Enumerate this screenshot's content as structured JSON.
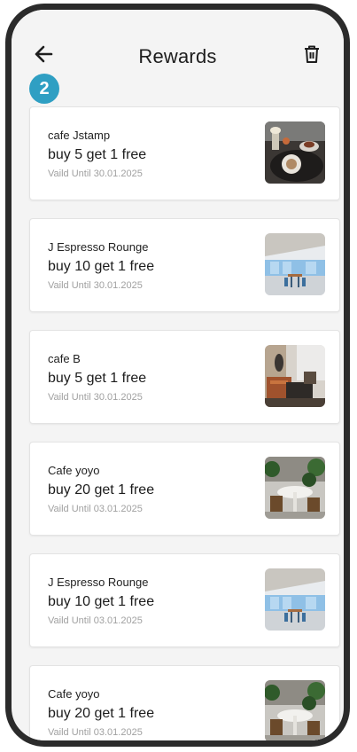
{
  "header": {
    "title": "Rewards",
    "back_icon": "arrow-left-icon",
    "trash_icon": "trash-icon"
  },
  "step_badge": "2",
  "rewards": [
    {
      "cafe": "cafe Jstamp",
      "offer": "buy 5 get 1 free",
      "valid": "Vaild Until 30.01.2025",
      "image": "cafe-dessert-photo"
    },
    {
      "cafe": "J Espresso Rounge",
      "offer": "buy 10 get 1 free",
      "valid": "Vaild Until 30.01.2025",
      "image": "cafe-interior-blue-photo"
    },
    {
      "cafe": "cafe B",
      "offer": "buy 5 get 1 free",
      "valid": "Vaild Until 30.01.2025",
      "image": "cafe-interior-brown-photo"
    },
    {
      "cafe": "Cafe yoyo",
      "offer": "buy 20 get 1 free",
      "valid": "Vaild Until 03.01.2025",
      "image": "cafe-table-plants-photo"
    },
    {
      "cafe": "J Espresso Rounge",
      "offer": "buy 10 get 1 free",
      "valid": "Vaild Until 03.01.2025",
      "image": "cafe-interior-blue-photo"
    },
    {
      "cafe": "Cafe yoyo",
      "offer": "buy 20 get 1 free",
      "valid": "Vaild Until 03.01.2025",
      "image": "cafe-table-plants-photo"
    }
  ],
  "colors": {
    "accent": "#2f9fc3",
    "background": "#f4f4f4",
    "card": "#ffffff"
  }
}
